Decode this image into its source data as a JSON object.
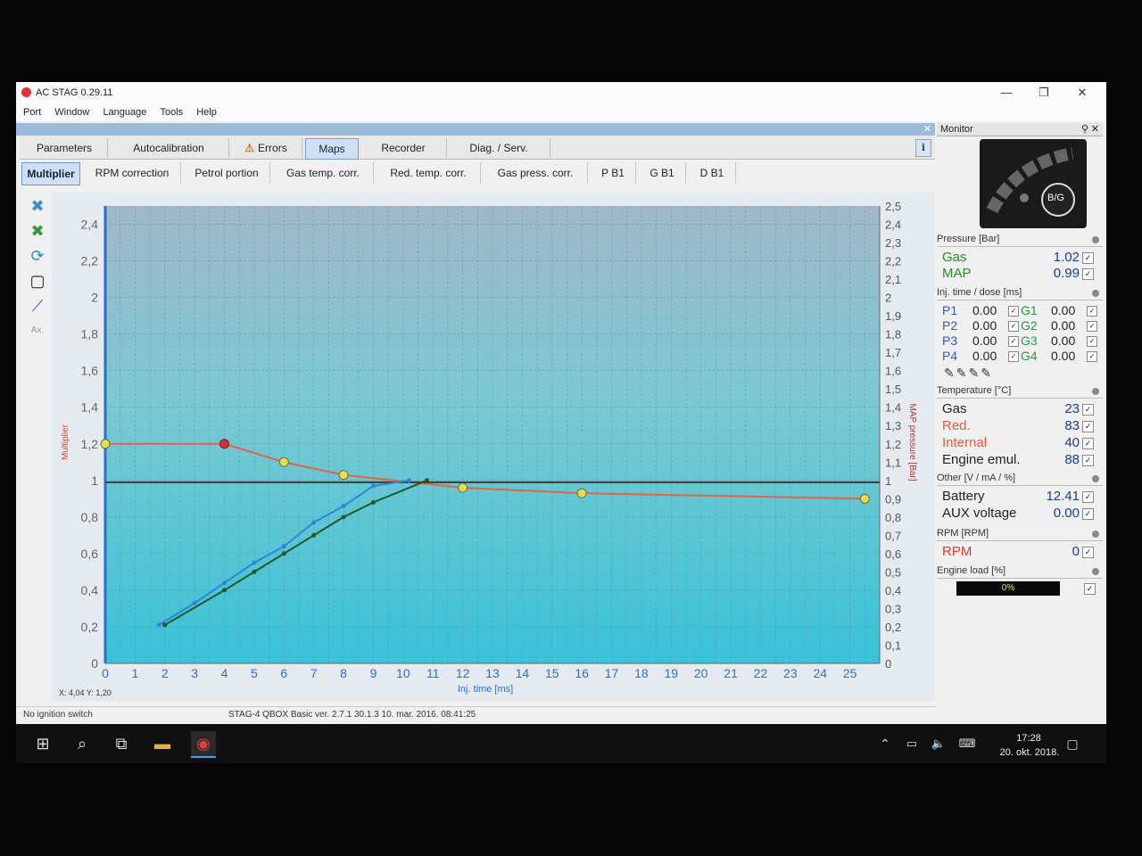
{
  "window": {
    "title": "AC STAG 0.29.11"
  },
  "menu": [
    "Port",
    "Window",
    "Language",
    "Tools",
    "Help"
  ],
  "tabs": [
    {
      "label": "Parameters"
    },
    {
      "label": "Autocalibration"
    },
    {
      "label": "Errors"
    },
    {
      "label": "Maps",
      "active": true
    },
    {
      "label": "Recorder"
    },
    {
      "label": "Diag. / Serv."
    }
  ],
  "subtabs": [
    {
      "label": "Multiplier",
      "active": true
    },
    {
      "label": "RPM correction"
    },
    {
      "label": "Petrol portion"
    },
    {
      "label": "Gas temp. corr."
    },
    {
      "label": "Red. temp. corr."
    },
    {
      "label": "Gas press. corr."
    },
    {
      "label": "P B1"
    },
    {
      "label": "G B1"
    },
    {
      "label": "D B1"
    }
  ],
  "toolbar": {
    "icons": [
      "check-blue-icon",
      "check-green-icon",
      "refresh-icon",
      "select-icon",
      "curve-icon",
      "axis-icon"
    ],
    "axis_label": "Ax."
  },
  "chart_data": {
    "type": "line",
    "xlabel": "Inj. time [ms]",
    "ylabel_left": "Multiplier",
    "ylabel_right": "MAP pressure [Bar]",
    "xlim": [
      0,
      26
    ],
    "ylim_left": [
      0,
      2.5
    ],
    "ylim_right": [
      0,
      2.5
    ],
    "x_ticks": [
      "0",
      "1",
      "2",
      "3",
      "4",
      "5",
      "6",
      "7",
      "8",
      "9",
      "10",
      "11",
      "12",
      "13",
      "14",
      "15",
      "16",
      "17",
      "18",
      "19",
      "20",
      "21",
      "22",
      "23",
      "24",
      "25"
    ],
    "y_left_ticks": [
      "0",
      "0,2",
      "0,4",
      "0,6",
      "0,8",
      "1",
      "1,2",
      "1,4",
      "1,6",
      "1,8",
      "2",
      "2,2",
      "2,4"
    ],
    "y_right_ticks": [
      "0",
      "0,1",
      "0,2",
      "0,3",
      "0,4",
      "0,5",
      "0,6",
      "0,7",
      "0,8",
      "0,9",
      "1",
      "1,1",
      "1,2",
      "1,3",
      "1,4",
      "1,5",
      "1,6",
      "1,7",
      "1,8",
      "1,9",
      "2",
      "2,1",
      "2,2",
      "2,3",
      "2,4",
      "2,5"
    ],
    "grid": true,
    "series": [
      {
        "color": "#e8604a",
        "x": [
          0,
          4,
          6,
          8,
          12,
          16,
          25.5
        ],
        "y": [
          1.2,
          1.2,
          1.1,
          1.03,
          0.96,
          0.93,
          0.9
        ]
      },
      {
        "color": "#3a3a3a",
        "x": [
          0,
          26
        ],
        "y": [
          0.99,
          0.99
        ]
      },
      {
        "color": "#2f86d8",
        "x": [
          1.8,
          3,
          4,
          5,
          6,
          7,
          8,
          9,
          10.2
        ],
        "y": [
          0.21,
          0.33,
          0.44,
          0.55,
          0.64,
          0.77,
          0.86,
          0.97,
          1.0
        ]
      },
      {
        "color": "#1f5a2a",
        "x": [
          2,
          4,
          5,
          6,
          7,
          8,
          9,
          10.8
        ],
        "y": [
          0.21,
          0.4,
          0.5,
          0.6,
          0.7,
          0.8,
          0.88,
          1.0
        ]
      }
    ],
    "points_red": [
      {
        "x": 4,
        "y": 1.2
      }
    ],
    "points_yellow": [
      {
        "x": 0,
        "y": 1.2
      },
      {
        "x": 6,
        "y": 1.1
      },
      {
        "x": 8,
        "y": 1.03
      },
      {
        "x": 12,
        "y": 0.96
      },
      {
        "x": 16,
        "y": 0.93
      },
      {
        "x": 25.5,
        "y": 0.9
      }
    ]
  },
  "cursor": {
    "readout": "X: 4,04  Y: 1,20"
  },
  "status": {
    "left": "No ignition switch",
    "center": "STAG-4 QBOX Basic  ver. 2.7.1  30.1.3  10. mar. 2016. 08:41:25"
  },
  "monitor": {
    "title": "Monitor",
    "gauge_label": "B/G",
    "pressure": {
      "header": "Pressure [Bar]",
      "rows": [
        {
          "label": "Gas",
          "value": "1.02"
        },
        {
          "label": "MAP",
          "value": "0.99"
        }
      ]
    },
    "injection": {
      "header": "Inj. time / dose [ms]",
      "rows": [
        {
          "p": "P1",
          "pv": "0.00",
          "g": "G1",
          "gv": "0.00"
        },
        {
          "p": "P2",
          "pv": "0.00",
          "g": "G2",
          "gv": "0.00"
        },
        {
          "p": "P3",
          "pv": "0.00",
          "g": "G3",
          "gv": "0.00"
        },
        {
          "p": "P4",
          "pv": "0.00",
          "g": "G4",
          "gv": "0.00"
        }
      ]
    },
    "temperature": {
      "header": "Temperature [°C]",
      "rows": [
        {
          "label": "Gas",
          "value": "23",
          "color": "#222222"
        },
        {
          "label": "Red.",
          "value": "83",
          "color": "#e05a3c"
        },
        {
          "label": "Internal",
          "value": "40",
          "color": "#e05a3c"
        },
        {
          "label": "Engine emul.",
          "value": "88",
          "color": "#222222"
        }
      ]
    },
    "other": {
      "header": "Other [V / mA / %]",
      "rows": [
        {
          "label": "Battery",
          "value": "12.41"
        },
        {
          "label": "AUX voltage",
          "value": "0.00"
        }
      ]
    },
    "rpm": {
      "header": "RPM [RPM]",
      "label": "RPM",
      "value": "0"
    },
    "load": {
      "header": "Engine load [%]",
      "value": "0%"
    }
  },
  "taskbar": {
    "time": "17:28",
    "date": "20. okt. 2018."
  }
}
